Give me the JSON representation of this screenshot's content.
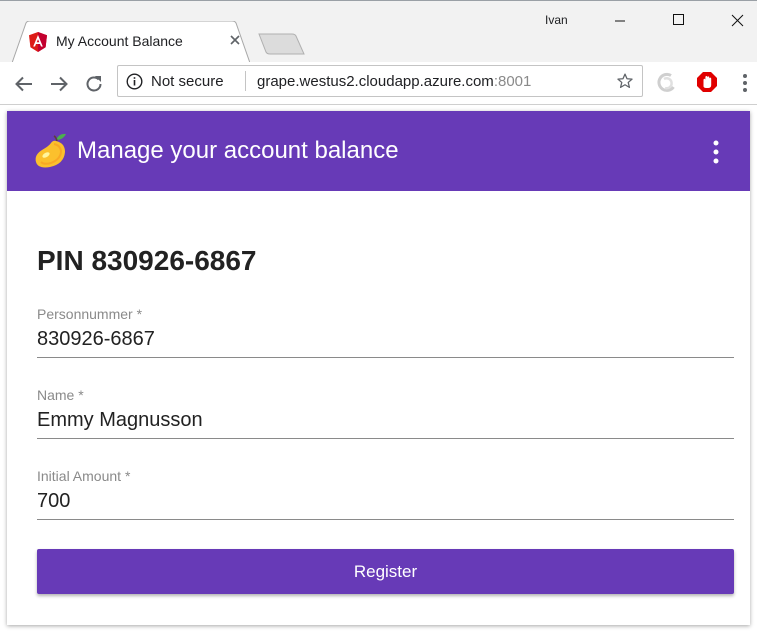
{
  "browser": {
    "tab_title": "My Account Balance",
    "user_name": "Ivan",
    "security_label": "Not secure",
    "url_host": "grape.westus2.cloudapp.azure.com",
    "url_port": ":8001"
  },
  "app": {
    "title": "Manage your account balance",
    "heading": "PIN 830926-6867",
    "fields": [
      {
        "label": "Personnummer *",
        "value": "830926-6867"
      },
      {
        "label": "Name *",
        "value": "Emmy Magnusson"
      },
      {
        "label": "Initial Amount *",
        "value": "700"
      }
    ],
    "register_label": "Register"
  },
  "colors": {
    "primary": "#673ab7",
    "angular_red": "#dd1b16",
    "adblock_red": "#e00000"
  }
}
